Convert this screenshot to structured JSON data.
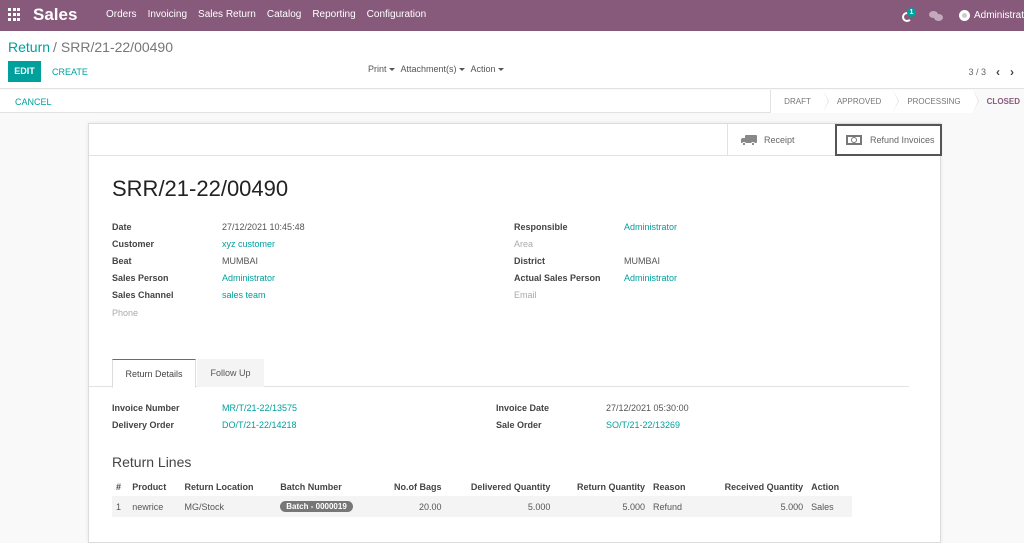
{
  "navbar": {
    "app_name": "Sales",
    "menu": [
      "Orders",
      "Invoicing",
      "Sales Return",
      "Catalog",
      "Reporting",
      "Configuration"
    ],
    "activity_badge": "1",
    "user_name": "Administrat"
  },
  "control_panel": {
    "breadcrumb_parent": "Return",
    "breadcrumb_separator": "/",
    "breadcrumb_current": "SRR/21-22/00490",
    "edit_label": "EDIT",
    "create_label": "CREATE",
    "actions": [
      "Print",
      "Attachment(s)",
      "Action"
    ],
    "pager": "3 / 3"
  },
  "statusbar": {
    "cancel_label": "CANCEL",
    "states": [
      {
        "label": "DRAFT",
        "active": false
      },
      {
        "label": "APPROVED",
        "active": false
      },
      {
        "label": "PROCESSING",
        "active": false
      },
      {
        "label": "CLOSED",
        "active": true
      }
    ]
  },
  "colors": {
    "brand": "#875a7b",
    "accent": "#00a09d"
  },
  "sheet": {
    "buttons": {
      "receipt": "Receipt",
      "refund_invoices": "Refund Invoices"
    },
    "title": "SRR/21-22/00490",
    "left_fields": [
      {
        "label": "Date",
        "value": "27/12/2021 10:45:48"
      },
      {
        "label": "Customer",
        "value": "xyz customer"
      },
      {
        "label": "Beat",
        "value": "MUMBAI"
      },
      {
        "label": "Sales Person",
        "value": "Administrator"
      },
      {
        "label": "Sales Channel",
        "value": "sales team"
      },
      {
        "label": "Phone",
        "value": ""
      }
    ],
    "right_fields": [
      {
        "label": "Responsible",
        "value": "Administrator"
      },
      {
        "label": "Area",
        "value": ""
      },
      {
        "label": "District",
        "value": "MUMBAI"
      },
      {
        "label": "Actual Sales Person",
        "value": "Administrator"
      },
      {
        "label": "Email",
        "value": ""
      }
    ],
    "tabs": [
      "Return Details",
      "Follow Up"
    ],
    "return_details": {
      "left": [
        {
          "label": "Invoice Number",
          "value": "MR/T/21-22/13575"
        },
        {
          "label": "Delivery Order",
          "value": "DO/T/21-22/14218"
        }
      ],
      "right": [
        {
          "label": "Invoice Date",
          "value": "27/12/2021 05:30:00"
        },
        {
          "label": "Sale Order",
          "value": "SO/T/21-22/13269"
        }
      ]
    },
    "return_lines": {
      "title": "Return Lines",
      "columns": [
        "#",
        "Product",
        "Return Location",
        "Batch Number",
        "No.of Bags",
        "Delivered Quantity",
        "Return Quantity",
        "Reason",
        "Received Quantity",
        "Action"
      ],
      "rows": [
        [
          "1",
          "newrice",
          "MG/Stock",
          "Batch - 0000019",
          "20.00",
          "5.000",
          "5.000",
          "Refund",
          "5.000",
          "Sales"
        ]
      ]
    }
  }
}
